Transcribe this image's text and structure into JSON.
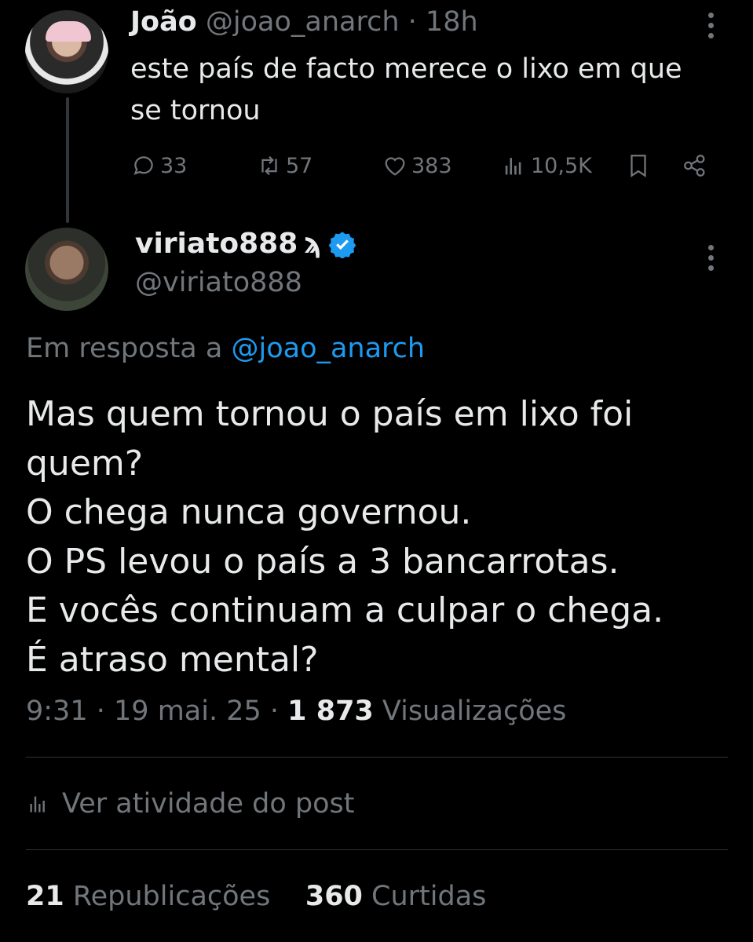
{
  "parent": {
    "name": "João",
    "handle": "@joao_anarch",
    "sep": "·",
    "time": "18h",
    "text_lines": [
      "este país de facto merece o lixo em que",
      "se tornou"
    ],
    "replies": "33",
    "reposts": "57",
    "likes": "383",
    "views": "10,5K"
  },
  "main": {
    "name": "viriato888",
    "name_glyph": "ϡ",
    "handle": "@viriato888",
    "reply_prefix": "Em resposta a",
    "reply_handle": "@joao_anarch",
    "lines": [
      "Mas quem tornou o país em lixo foi",
      "quem?",
      "O chega nunca governou.",
      "O PS levou o país a 3 bancarrotas.",
      "E vocês continuam a culpar o chega.",
      "É atraso mental?"
    ],
    "time": "9:31",
    "date": "19 mai. 25",
    "views_count": "1 873",
    "views_label": "Visualizações",
    "activity_label": "Ver atividade do post",
    "reposts_count": "21",
    "reposts_label": "Republicações",
    "likes_count": "360",
    "likes_label": "Curtidas"
  },
  "colors": {
    "accent": "#1d9bf0",
    "muted": "#71767b",
    "text": "#e7e9ea",
    "background": "#000000"
  },
  "icons": [
    "reply-icon",
    "repost-icon",
    "like-icon",
    "views-icon",
    "bookmark-icon",
    "share-icon",
    "more-icon",
    "verified-badge-icon"
  ]
}
